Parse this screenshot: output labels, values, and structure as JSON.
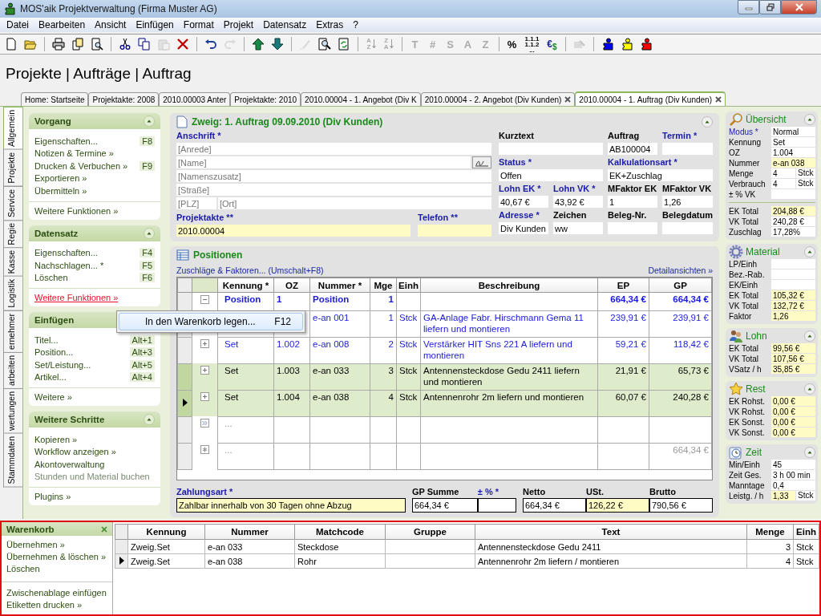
{
  "window": {
    "title": "MOS'aik Projektverwaltung (Firma Muster AG)"
  },
  "menu": [
    "Datei",
    "Bearbeiten",
    "Ansicht",
    "Einfügen",
    "Format",
    "Projekt",
    "Datensatz",
    "Extras",
    "?"
  ],
  "toolbar": [
    {
      "kind": "new",
      "disabled": false
    },
    {
      "kind": "open",
      "disabled": false
    },
    {
      "kind": "separator"
    },
    {
      "kind": "print",
      "disabled": false
    },
    {
      "kind": "pages",
      "disabled": false
    },
    {
      "kind": "preview",
      "disabled": false
    },
    {
      "kind": "separator"
    },
    {
      "kind": "cut",
      "disabled": false
    },
    {
      "kind": "copy",
      "disabled": false
    },
    {
      "kind": "paste",
      "disabled": true
    },
    {
      "kind": "delete",
      "disabled": false
    },
    {
      "kind": "separator"
    },
    {
      "kind": "undo",
      "disabled": false
    },
    {
      "kind": "redo",
      "disabled": true
    },
    {
      "kind": "separator"
    },
    {
      "kind": "up",
      "disabled": false
    },
    {
      "kind": "down",
      "disabled": false
    },
    {
      "kind": "separator"
    },
    {
      "kind": "pencil",
      "disabled": true
    },
    {
      "kind": "find",
      "disabled": false
    },
    {
      "kind": "refresh",
      "disabled": false
    },
    {
      "kind": "separator"
    },
    {
      "kind": "sort",
      "label": "A\nZ",
      "disabled": true
    },
    {
      "kind": "sort",
      "label": "Z\nA",
      "disabled": true
    },
    {
      "kind": "separator"
    },
    {
      "kind": "glyph",
      "label": "T",
      "disabled": true
    },
    {
      "kind": "glyph",
      "label": "#",
      "disabled": true
    },
    {
      "kind": "glyph",
      "label": "S",
      "disabled": true
    },
    {
      "kind": "glyph",
      "label": "A",
      "disabled": true
    },
    {
      "kind": "glyph",
      "label": "Z",
      "disabled": true
    },
    {
      "kind": "separator"
    },
    {
      "kind": "glyph",
      "label": "%",
      "disabled": false
    },
    {
      "kind": "numbering",
      "label": "1.1.1\n1.1.2\n...",
      "disabled": false
    },
    {
      "kind": "currency",
      "label": "€",
      "label2": "$",
      "disabled": false
    },
    {
      "kind": "separator"
    },
    {
      "kind": "mail",
      "disabled": true
    },
    {
      "kind": "separator"
    },
    {
      "kind": "puzzle",
      "color": "#0000ff",
      "disabled": false
    },
    {
      "kind": "puzzle",
      "color": "#ffff00",
      "disabled": false
    },
    {
      "kind": "puzzle",
      "color": "#ff0000",
      "disabled": false
    }
  ],
  "heading": "Projekte | Aufträge | Auftrag",
  "tabs": [
    {
      "label": "Home: Startseite",
      "selected": false,
      "closable": false
    },
    {
      "label": "Projektakte: 2008",
      "selected": false,
      "closable": false
    },
    {
      "label": "2010.00003 Anter",
      "selected": false,
      "closable": false
    },
    {
      "label": "Projektakte: 2010",
      "selected": false,
      "closable": false
    },
    {
      "label": "2010.00004 - 1. Angebot (Div K",
      "selected": false,
      "closable": false
    },
    {
      "label": "2010.00004 - 2. Angebot (Div Kunden)",
      "selected": false,
      "closable": true
    },
    {
      "label": "2010.00004 - 1. Auftrag (Div Kunden)",
      "selected": true,
      "closable": true
    }
  ],
  "side_tabs": [
    {
      "label": "Allgemein",
      "selected": true
    },
    {
      "label": "Projekte",
      "selected": false
    },
    {
      "label": "Service",
      "selected": false
    },
    {
      "label": "Regie",
      "selected": false
    },
    {
      "label": "Kasse",
      "selected": false
    },
    {
      "label": "Logistik",
      "selected": false
    },
    {
      "label": "ernehmer",
      "selected": false
    },
    {
      "label": "arbeiten",
      "selected": false
    },
    {
      "label": "wertungen",
      "selected": false
    },
    {
      "label": "Stammdaten",
      "selected": false
    }
  ],
  "sidebar": [
    {
      "title": "Vorgang",
      "items": [
        {
          "label": "Eigenschaften...",
          "shortcut": "F8",
          "disabled": false
        },
        {
          "label": "Notizen & Termine »",
          "disabled": false
        },
        {
          "label": "Drucken & Verbuchen »",
          "shortcut": "F9",
          "disabled": false
        },
        {
          "label": "Exportieren »",
          "disabled": false
        },
        {
          "label": "Übermitteln »",
          "disabled": false
        }
      ],
      "footer": [
        {
          "label": "Weitere Funktionen »",
          "hovered": false
        }
      ]
    },
    {
      "title": "Datensatz",
      "items": [
        {
          "label": "Eigenschaften...",
          "shortcut": "F4",
          "disabled": false
        },
        {
          "label": "Nachschlagen... *",
          "shortcut": "F5",
          "disabled": false
        },
        {
          "label": "Löschen",
          "shortcut": "F6",
          "disabled": false
        }
      ],
      "footer": [
        {
          "label": "Weitere Funktionen »",
          "hovered": true
        }
      ]
    },
    {
      "title": "Einfügen",
      "items": [
        {
          "label": "Titel...",
          "shortcut": "Alt+1",
          "disabled": false
        },
        {
          "label": "Position...",
          "shortcut": "Alt+3",
          "disabled": false
        },
        {
          "label": "Set/Leistung...",
          "shortcut": "Alt+5",
          "disabled": false
        },
        {
          "label": "Artikel...",
          "shortcut": "Alt+4",
          "disabled": false
        }
      ],
      "footer": [
        {
          "label": "Weitere »",
          "hovered": false
        }
      ]
    },
    {
      "title": "Weitere Schritte",
      "items": [
        {
          "label": "Kopieren »",
          "disabled": false
        },
        {
          "label": "Workflow anzeigen »",
          "disabled": false
        },
        {
          "label": "Akontoverwaltung",
          "disabled": false
        },
        {
          "label": "Stunden und Material buchen",
          "disabled": true
        }
      ],
      "footer": [
        {
          "label": "Plugins »",
          "hovered": false
        }
      ]
    }
  ],
  "context_menu": {
    "label": "In den Warenkorb legen...",
    "shortcut": "F12"
  },
  "document": {
    "title": "Zweig: 1. Auftrag 09.09.2010 (Div Kunden)",
    "address": {
      "label": "Anschrift *",
      "required": true,
      "lines": [
        {
          "placeholder": "[Anrede]",
          "lookup": false
        },
        {
          "placeholder": "[Name]",
          "lookup": true
        },
        {
          "placeholder": "[Namenszusatz]",
          "lookup": false
        },
        {
          "placeholder": "[Straße]",
          "lookup": false
        }
      ],
      "plz": {
        "placeholder": "[PLZ]"
      },
      "ort": {
        "placeholder": "[Ort]"
      }
    },
    "project_fields": [
      {
        "label": "Projektakte **",
        "required": true,
        "value": "2010.00004",
        "highlighted": true
      },
      {
        "label": "Telefon **",
        "required": true,
        "highlighted": true
      }
    ],
    "detail_rows": [
      [
        {
          "label": "Kurztext",
          "required": false,
          "highlighted": false
        },
        {
          "label": "Auftrag",
          "required": false,
          "value": "AB100004",
          "highlighted": false
        },
        {
          "label": "Termin *",
          "required": true,
          "highlighted": false
        }
      ],
      [
        {
          "label": "Status *",
          "required": true,
          "value": "Offen",
          "highlighted": false
        },
        {
          "label": "Kalkulationsart *",
          "required": true,
          "value": "EK+Zuschlag",
          "highlighted": false
        }
      ],
      [
        {
          "label": "Lohn EK *",
          "required": true,
          "value": "40,67 €",
          "highlighted": false
        },
        {
          "label": "Lohn VK *",
          "required": true,
          "value": "43,92 €",
          "highlighted": false
        },
        {
          "label": "MFaktor EK",
          "required": false,
          "value": "1",
          "highlighted": false
        },
        {
          "label": "MFaktor VK",
          "required": false,
          "value": "1,26",
          "highlighted": false
        }
      ],
      [
        {
          "label": "Adresse *",
          "required": true,
          "value": "Div Kunden",
          "highlighted": false
        },
        {
          "label": "Zeichen",
          "required": false,
          "value": "ww",
          "highlighted": false
        },
        {
          "label": "Beleg-Nr.",
          "required": false,
          "highlighted": false
        },
        {
          "label": "Belegdatum",
          "required": false,
          "highlighted": false
        }
      ]
    ]
  },
  "positions": {
    "title": "Positionen",
    "surcharge_link": "Zuschläge & Faktoren... (Umschalt+F8)",
    "details_link": "Detailansichten »",
    "columns": [
      "Kennung *",
      "OZ",
      "Nummer *",
      "Mge",
      "Einh",
      "Beschreibung",
      "EP",
      "GP"
    ],
    "rows": [
      {
        "kind": "title",
        "expanded": true,
        "selected": false,
        "current": false,
        "kennung": "Position",
        "oz": "1",
        "nummer": "Position",
        "mge": "1",
        "ep": "664,34 €",
        "gp": "664,34 €"
      },
      {
        "kind": "set",
        "selected": false,
        "nummer": "e-an 001",
        "mge": "1",
        "einh": "Stck",
        "beschreibung": "GA-Anlage Fabr. Hirschmann Gema 11 liefern und montieren",
        "ep": "239,91 €",
        "gp": "239,91 €"
      },
      {
        "kind": "set",
        "expanded": false,
        "selected": false,
        "current": false,
        "kennung": "Set",
        "oz": "1.002",
        "nummer": "e-an 008",
        "mge": "2",
        "einh": "Stck",
        "beschreibung": "Verstärker HIT Sns 221 A liefern und montieren",
        "ep": "59,21 €",
        "gp": "118,42 €"
      },
      {
        "kind": "set",
        "expanded": false,
        "selected": true,
        "current": false,
        "kennung": "Set",
        "oz": "1.003",
        "nummer": "e-an 033",
        "mge": "3",
        "einh": "Stck",
        "beschreibung": "Antennensteckdose Gedu 2411 liefern und montieren",
        "ep": "21,91 €",
        "gp": "65,73 €"
      },
      {
        "kind": "set",
        "expanded": false,
        "selected": true,
        "current": true,
        "kennung": "Set",
        "oz": "1.004",
        "nummer": "e-an 038",
        "mge": "4",
        "einh": "Stck",
        "beschreibung": "Antennenrohr 2m liefern und montieren",
        "ep": "60,07 €",
        "gp": "240,28 €"
      },
      {
        "kind": "more",
        "selected": false,
        "current": false,
        "kennung": "..."
      },
      {
        "kind": "new",
        "selected": false,
        "current": false,
        "kennung": "...",
        "gp": "664,34 €"
      }
    ]
  },
  "totals": [
    [
      {
        "label": "Zahlungsart *",
        "required": true,
        "value": "Zahlbar innerhalb von 30 Tagen ohne Abzug",
        "highlighted": true
      }
    ],
    [
      {
        "label": "GP Summe",
        "required": false,
        "value": "664,34 €",
        "highlighted": false
      },
      {
        "label": "± % *",
        "required": true,
        "highlighted": false
      }
    ],
    [
      {
        "label": "Netto",
        "required": false,
        "value": "664,34 €",
        "highlighted": false
      },
      {
        "label": "USt.",
        "required": false,
        "value": "126,22 €",
        "highlighted": true
      },
      {
        "label": "Brutto",
        "required": false,
        "value": "790,56 €",
        "highlighted": false
      }
    ]
  ],
  "summary_panels": [
    {
      "kind": "overview",
      "title": "Übersicht",
      "groups": [
        [
          {
            "label": "Modus *",
            "required": true,
            "value": "Normal",
            "highlighted": false
          },
          {
            "label": "Kennung",
            "required": false,
            "value": "Set",
            "highlighted": false
          },
          {
            "label": "OZ",
            "required": false,
            "value": "1.004",
            "highlighted": false
          },
          {
            "label": "Nummer",
            "required": false,
            "value": "e-an 038",
            "highlighted": true
          },
          {
            "label": "Menge",
            "required": false,
            "value": "4",
            "unit": "Stck",
            "highlighted": false
          },
          {
            "label": "Verbrauch",
            "required": false,
            "value": "4",
            "unit": "Stck",
            "highlighted": false
          },
          {
            "label": "± % VK",
            "required": false,
            "highlighted": false
          }
        ],
        [
          {
            "label": "EK Total",
            "required": false,
            "value": "204,88 €",
            "highlighted": true
          },
          {
            "label": "VK Total",
            "required": false,
            "value": "240,28 €",
            "highlighted": false
          },
          {
            "label": "Zuschlag",
            "required": false,
            "value": "17,28%",
            "highlighted": false
          }
        ]
      ]
    },
    {
      "kind": "material",
      "title": "Material",
      "groups": [
        [
          {
            "label": "LP/Einh",
            "required": false,
            "highlighted": false
          },
          {
            "label": "Bez.-Rab.",
            "required": false,
            "highlighted": false
          },
          {
            "label": "EK/Einh",
            "required": false,
            "highlighted": false
          },
          {
            "label": "EK Total",
            "required": false,
            "value": "105,32 €",
            "highlighted": true
          },
          {
            "label": "VK Total",
            "required": false,
            "value": "132,72 €",
            "highlighted": true
          },
          {
            "label": "Faktor",
            "required": false,
            "value": "1,26",
            "highlighted": true
          }
        ]
      ]
    },
    {
      "kind": "labor",
      "title": "Lohn",
      "groups": [
        [
          {
            "label": "EK Total",
            "required": false,
            "value": "99,56 €",
            "highlighted": true
          },
          {
            "label": "VK Total",
            "required": false,
            "value": "107,56 €",
            "highlighted": true
          },
          {
            "label": "VSatz / h",
            "required": false,
            "value": "35,85 €",
            "highlighted": true
          }
        ]
      ]
    },
    {
      "kind": "rest",
      "title": "Rest",
      "groups": [
        [
          {
            "label": "EK Rohst.",
            "required": false,
            "value": "0,00 €",
            "highlighted": true
          },
          {
            "label": "VK Rohst.",
            "required": false,
            "value": "0,00 €",
            "highlighted": true
          },
          {
            "label": "EK Sonst.",
            "required": false,
            "value": "0,00 €",
            "highlighted": true
          },
          {
            "label": "VK Sonst.",
            "required": false,
            "value": "0,00 €",
            "highlighted": true
          }
        ]
      ]
    },
    {
      "kind": "time",
      "title": "Zeit",
      "groups": [
        [
          {
            "label": "Min/Einh",
            "required": false,
            "value": "45",
            "highlighted": false
          },
          {
            "label": "Zeit Ges.",
            "required": false,
            "value": "3 h 00 min",
            "highlighted": false
          },
          {
            "label": "Manntage",
            "required": false,
            "value": "0,4",
            "highlighted": false
          },
          {
            "label": "Leistg. / h",
            "required": false,
            "value": "1,33",
            "unit": "Stck",
            "highlighted": true
          }
        ]
      ]
    }
  ],
  "basket": {
    "title": "Warenkorb",
    "link_groups": [
      [
        "Übernehmen »",
        "Übernehmen & löschen »",
        "Löschen"
      ],
      [
        "Zwischenablage einfügen",
        "Etiketten drucken »"
      ]
    ],
    "columns": [
      "Kennung",
      "Nummer",
      "Matchcode",
      "Gruppe",
      "Text",
      "Menge",
      "Einh"
    ],
    "rows": [
      {
        "current": false,
        "kennung": "Zweig.Set",
        "nummer": "e-an 033",
        "matchcode": "Steckdose",
        "text": "Antennensteckdose Gedu 2411",
        "menge": "3",
        "einh": "Stck"
      },
      {
        "current": true,
        "kennung": "Zweig.Set",
        "nummer": "e-an 038",
        "matchcode": "Rohr",
        "text": "Antennenrohr 2m liefern / montieren",
        "menge": "4",
        "einh": "Stck"
      }
    ]
  }
}
